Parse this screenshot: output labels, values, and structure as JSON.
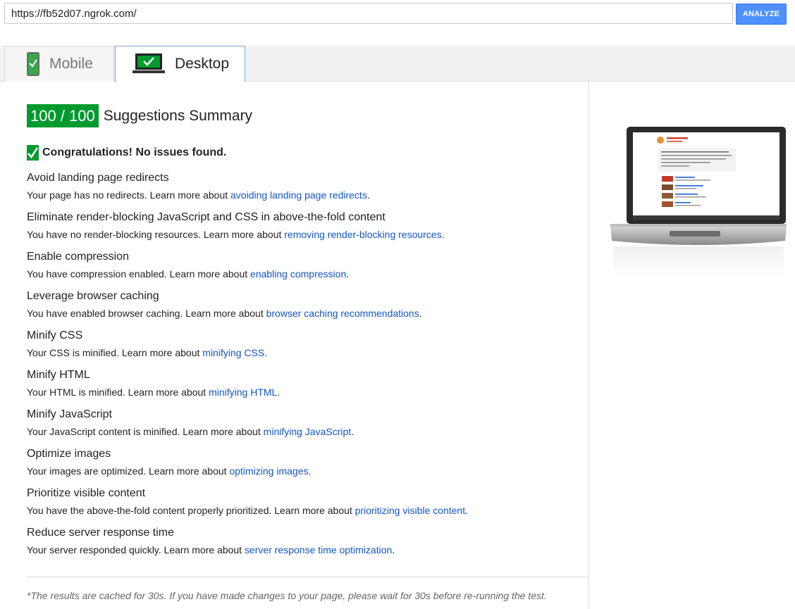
{
  "url_bar": {
    "value": "https://fb52d07.ngrok.com/",
    "analyze_label": "ANALYZE"
  },
  "tabs": {
    "mobile": "Mobile",
    "desktop": "Desktop"
  },
  "summary": {
    "score": "100 / 100",
    "title": "Suggestions Summary",
    "congrats": "Congratulations! No issues found."
  },
  "rules": [
    {
      "title": "Avoid landing page redirects",
      "desc": "Your page has no redirects. Learn more about ",
      "link": "avoiding landing page redirects"
    },
    {
      "title": "Eliminate render-blocking JavaScript and CSS in above-the-fold content",
      "desc": "You have no render-blocking resources. Learn more about ",
      "link": "removing render-blocking resources"
    },
    {
      "title": "Enable compression",
      "desc": "You have compression enabled. Learn more about ",
      "link": "enabling compression"
    },
    {
      "title": "Leverage browser caching",
      "desc": "You have enabled browser caching. Learn more about ",
      "link": "browser caching recommendations"
    },
    {
      "title": "Minify CSS",
      "desc": "Your CSS is minified. Learn more about ",
      "link": "minifying CSS"
    },
    {
      "title": "Minify HTML",
      "desc": "Your HTML is minified. Learn more about ",
      "link": "minifying HTML"
    },
    {
      "title": "Minify JavaScript",
      "desc": "Your JavaScript content is minified. Learn more about ",
      "link": "minifying JavaScript"
    },
    {
      "title": "Optimize images",
      "desc": "Your images are optimized. Learn more about ",
      "link": "optimizing images"
    },
    {
      "title": "Prioritize visible content",
      "desc": "You have the above-the-fold content properly prioritized. Learn more about ",
      "link": "prioritizing visible content"
    },
    {
      "title": "Reduce server response time",
      "desc": "Your server responded quickly. Learn more about ",
      "link": "server response time optimization"
    }
  ],
  "footnote": "*The results are cached for 30s. If you have made changes to your page, please wait for 30s before re-running the test.",
  "colors": {
    "score_green": "#009a2e",
    "link_blue": "#1155cc",
    "analyze_blue": "#4d90fe"
  },
  "icons": {
    "mobile_tab": "phone-check-icon",
    "desktop_tab": "monitor-check-icon",
    "congrats": "checkmark-icon"
  }
}
